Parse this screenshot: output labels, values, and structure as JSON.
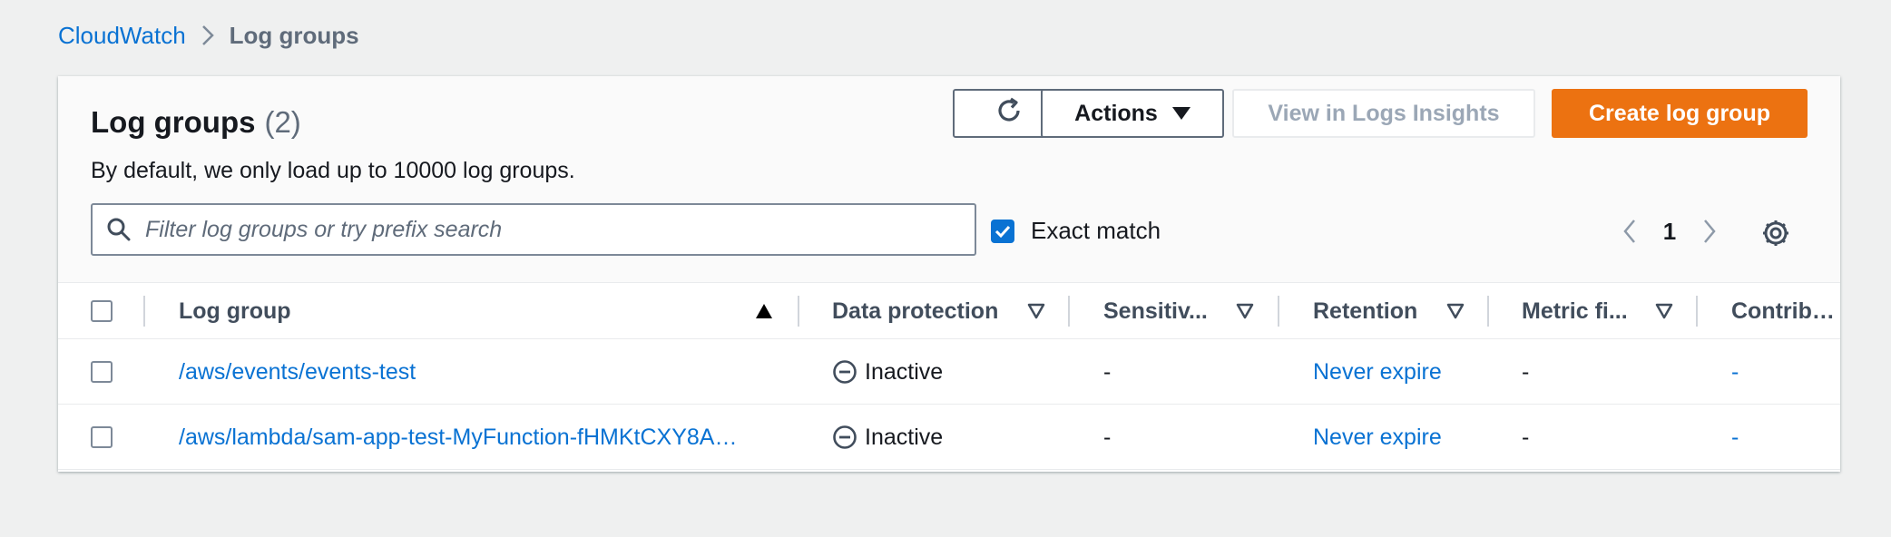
{
  "breadcrumb": {
    "root": "CloudWatch",
    "current": "Log groups"
  },
  "header": {
    "title": "Log groups",
    "count": "(2)",
    "description": "By default, we only load up to 10000 log groups.",
    "actions_label": "Actions",
    "insights_label": "View in Logs Insights",
    "create_label": "Create log group"
  },
  "filter": {
    "placeholder": "Filter log groups or try prefix search",
    "exact_match_label": "Exact match",
    "exact_match_checked": true
  },
  "pagination": {
    "current_page": "1"
  },
  "table": {
    "columns": [
      "Log group",
      "Data protection",
      "Sensitiv...",
      "Retention",
      "Metric fi...",
      "Contribu..."
    ],
    "rows": [
      {
        "log_group": "/aws/events/events-test",
        "data_protection": "Inactive",
        "sensitive": "-",
        "retention": "Never expire",
        "metric_filters": "-",
        "contributor": "-"
      },
      {
        "log_group": "/aws/lambda/sam-app-test-MyFunction-fHMKtCXY8A…",
        "data_protection": "Inactive",
        "sensitive": "-",
        "retention": "Never expire",
        "metric_filters": "-",
        "contributor": "-"
      }
    ]
  },
  "colors": {
    "link": "#0972d3",
    "primary_button": "#ec7211",
    "page_background": "#eff0f0"
  }
}
